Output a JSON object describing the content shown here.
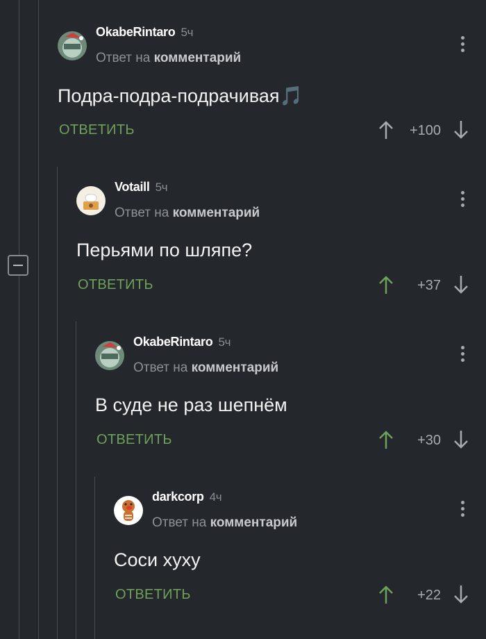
{
  "comments": [
    {
      "username": "OkabeRintaro",
      "time": "5ч",
      "reply_prefix": "Ответ на",
      "reply_target": "комментарий",
      "text": "Подра-подра-подрачивая",
      "emoji": "🎵",
      "reply_label": "ОТВЕТИТЬ",
      "rating": "+100",
      "upvoted": false,
      "avatar": "okabe-avatar"
    },
    {
      "username": "Votaill",
      "time": "5ч",
      "reply_prefix": "Ответ на",
      "reply_target": "комментарий",
      "text": "Перьями по шляпе?",
      "reply_label": "ОТВЕТИТЬ",
      "rating": "+37",
      "upvoted": true,
      "avatar": "votaill-avatar"
    },
    {
      "username": "OkabeRintaro",
      "time": "5ч",
      "reply_prefix": "Ответ на",
      "reply_target": "комментарий",
      "text": "В суде не раз шепнём",
      "reply_label": "ОТВЕТИТЬ",
      "rating": "+30",
      "upvoted": true,
      "avatar": "okabe-avatar"
    },
    {
      "username": "darkcorp",
      "time": "4ч",
      "reply_prefix": "Ответ на",
      "reply_target": "комментарий",
      "text": "Соси хуху",
      "reply_label": "ОТВЕТИТЬ",
      "rating": "+22",
      "upvoted": true,
      "avatar": "darkcorp-avatar"
    }
  ],
  "colors": {
    "background": "#24272b",
    "accent_green": "#6ea25a",
    "muted": "#8e9196"
  }
}
